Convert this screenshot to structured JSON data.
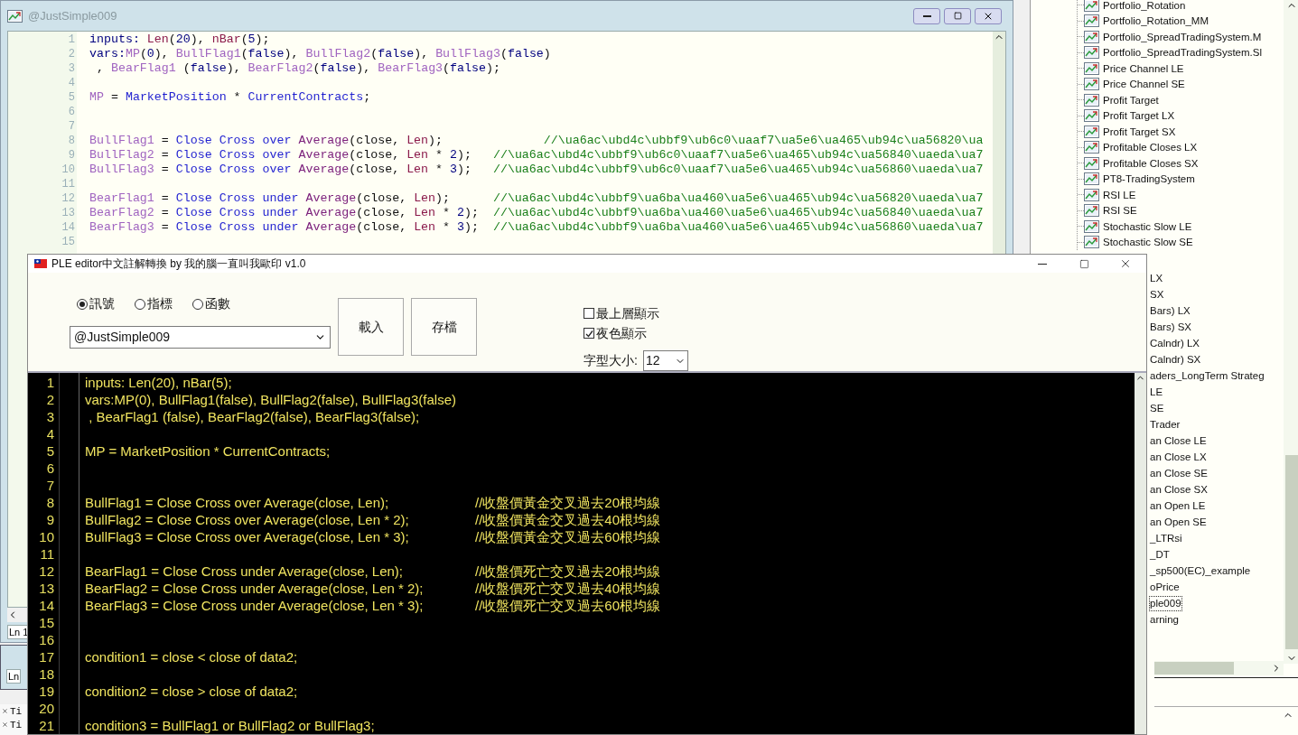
{
  "editor_window": {
    "title": "@JustSimple009",
    "lines": [
      {
        "number": "1",
        "tokens": [
          {
            "text": "inputs: ",
            "kind": "kw"
          },
          {
            "text": "Len",
            "kind": "inp"
          },
          {
            "text": "(",
            "kind": "p"
          },
          {
            "text": "20",
            "kind": "num"
          },
          {
            "text": "), ",
            "kind": "p"
          },
          {
            "text": "nBar",
            "kind": "inp"
          },
          {
            "text": "(",
            "kind": "p"
          },
          {
            "text": "5",
            "kind": "num"
          },
          {
            "text": ");",
            "kind": "p"
          }
        ]
      },
      {
        "number": "2",
        "tokens": [
          {
            "text": "vars:",
            "kind": "kw"
          },
          {
            "text": "MP",
            "kind": "var"
          },
          {
            "text": "(",
            "kind": "p"
          },
          {
            "text": "0",
            "kind": "num"
          },
          {
            "text": "), ",
            "kind": "p"
          },
          {
            "text": "BullFlag1",
            "kind": "var"
          },
          {
            "text": "(",
            "kind": "p"
          },
          {
            "text": "false",
            "kind": "kw"
          },
          {
            "text": "), ",
            "kind": "p"
          },
          {
            "text": "BullFlag2",
            "kind": "var"
          },
          {
            "text": "(",
            "kind": "p"
          },
          {
            "text": "false",
            "kind": "kw"
          },
          {
            "text": "), ",
            "kind": "p"
          },
          {
            "text": "BullFlag3",
            "kind": "var"
          },
          {
            "text": "(",
            "kind": "p"
          },
          {
            "text": "false",
            "kind": "kw"
          },
          {
            "text": ")",
            "kind": "p"
          }
        ]
      },
      {
        "number": "3",
        "tokens": [
          {
            "text": " , ",
            "kind": "p"
          },
          {
            "text": "BearFlag1",
            "kind": "var"
          },
          {
            "text": " (",
            "kind": "p"
          },
          {
            "text": "false",
            "kind": "kw"
          },
          {
            "text": "), ",
            "kind": "p"
          },
          {
            "text": "BearFlag2",
            "kind": "var"
          },
          {
            "text": "(",
            "kind": "p"
          },
          {
            "text": "false",
            "kind": "kw"
          },
          {
            "text": "), ",
            "kind": "p"
          },
          {
            "text": "BearFlag3",
            "kind": "var"
          },
          {
            "text": "(",
            "kind": "p"
          },
          {
            "text": "false",
            "kind": "kw"
          },
          {
            "text": ");",
            "kind": "p"
          }
        ]
      },
      {
        "number": "4"
      },
      {
        "number": "5",
        "tokens": [
          {
            "text": "MP",
            "kind": "var"
          },
          {
            "text": " = ",
            "kind": "p"
          },
          {
            "text": "MarketPosition",
            "kind": "fn"
          },
          {
            "text": " * ",
            "kind": "p"
          },
          {
            "text": "CurrentContracts",
            "kind": "fn"
          },
          {
            "text": ";",
            "kind": "p"
          }
        ]
      },
      {
        "number": "6"
      },
      {
        "number": "7"
      },
      {
        "number": "8",
        "tokens": [
          {
            "text": "BullFlag1",
            "kind": "var"
          },
          {
            "text": " = ",
            "kind": "p"
          },
          {
            "text": "Close Cross over ",
            "kind": "fn"
          },
          {
            "text": "Average",
            "kind": "avg"
          },
          {
            "text": "(close, ",
            "kind": "p"
          },
          {
            "text": "Len",
            "kind": "inp"
          },
          {
            "text": ");              ",
            "kind": "p"
          },
          {
            "text": "//\\ua6ac\\ubd4c\\ubbf9\\ub6c0\\uaaf7\\ua5e6\\ua465\\ub94c\\ua56820\\ua",
            "kind": "cm"
          }
        ]
      },
      {
        "number": "9",
        "tokens": [
          {
            "text": "BullFlag2",
            "kind": "var"
          },
          {
            "text": " = ",
            "kind": "p"
          },
          {
            "text": "Close Cross over ",
            "kind": "fn"
          },
          {
            "text": "Average",
            "kind": "avg"
          },
          {
            "text": "(close, ",
            "kind": "p"
          },
          {
            "text": "Len",
            "kind": "inp"
          },
          {
            "text": " * ",
            "kind": "p"
          },
          {
            "text": "2",
            "kind": "num"
          },
          {
            "text": ");   ",
            "kind": "p"
          },
          {
            "text": "//\\ua6ac\\ubd4c\\ubbf9\\ub6c0\\uaaf7\\ua5e6\\ua465\\ub94c\\ua56840\\uaeda\\ua7",
            "kind": "cm"
          }
        ]
      },
      {
        "number": "10",
        "tokens": [
          {
            "text": "BullFlag3",
            "kind": "var"
          },
          {
            "text": " = ",
            "kind": "p"
          },
          {
            "text": "Close Cross over ",
            "kind": "fn"
          },
          {
            "text": "Average",
            "kind": "avg"
          },
          {
            "text": "(close, ",
            "kind": "p"
          },
          {
            "text": "Len",
            "kind": "inp"
          },
          {
            "text": " * ",
            "kind": "p"
          },
          {
            "text": "3",
            "kind": "num"
          },
          {
            "text": ");   ",
            "kind": "p"
          },
          {
            "text": "//\\ua6ac\\ubd4c\\ubbf9\\ub6c0\\uaaf7\\ua5e6\\ua465\\ub94c\\ua56860\\uaeda\\ua7",
            "kind": "cm"
          }
        ]
      },
      {
        "number": "11"
      },
      {
        "number": "12",
        "tokens": [
          {
            "text": "BearFlag1",
            "kind": "var"
          },
          {
            "text": " = ",
            "kind": "p"
          },
          {
            "text": "Close Cross under ",
            "kind": "fn"
          },
          {
            "text": "Average",
            "kind": "avg"
          },
          {
            "text": "(close, ",
            "kind": "p"
          },
          {
            "text": "Len",
            "kind": "inp"
          },
          {
            "text": ");      ",
            "kind": "p"
          },
          {
            "text": "//\\ua6ac\\ubd4c\\ubbf9\\ua6ba\\ua460\\ua5e6\\ua465\\ub94c\\ua56820\\uaeda\\ua7",
            "kind": "cm"
          }
        ]
      },
      {
        "number": "13",
        "tokens": [
          {
            "text": "BearFlag2",
            "kind": "var"
          },
          {
            "text": " = ",
            "kind": "p"
          },
          {
            "text": "Close Cross under ",
            "kind": "fn"
          },
          {
            "text": "Average",
            "kind": "avg"
          },
          {
            "text": "(close, ",
            "kind": "p"
          },
          {
            "text": "Len",
            "kind": "inp"
          },
          {
            "text": " * ",
            "kind": "p"
          },
          {
            "text": "2",
            "kind": "num"
          },
          {
            "text": ");  ",
            "kind": "p"
          },
          {
            "text": "//\\ua6ac\\ubd4c\\ubbf9\\ua6ba\\ua460\\ua5e6\\ua465\\ub94c\\ua56840\\uaeda\\ua7",
            "kind": "cm"
          }
        ]
      },
      {
        "number": "14",
        "tokens": [
          {
            "text": "BearFlag3",
            "kind": "var"
          },
          {
            "text": " = ",
            "kind": "p"
          },
          {
            "text": "Close Cross under ",
            "kind": "fn"
          },
          {
            "text": "Average",
            "kind": "avg"
          },
          {
            "text": "(close, ",
            "kind": "p"
          },
          {
            "text": "Len",
            "kind": "inp"
          },
          {
            "text": " * ",
            "kind": "p"
          },
          {
            "text": "3",
            "kind": "num"
          },
          {
            "text": ");  ",
            "kind": "p"
          },
          {
            "text": "//\\ua6ac\\ubd4c\\ubbf9\\ua6ba\\ua460\\ua5e6\\ua465\\ub94c\\ua56860\\uaeda\\ua7",
            "kind": "cm"
          }
        ]
      },
      {
        "number": "15"
      }
    ]
  },
  "left_status": {
    "position_1": "Ln 1",
    "position_2": "Ln",
    "log_lines": [
      "Ti",
      "Ti"
    ]
  },
  "strategy_tree": {
    "items": [
      {
        "label": "Portfolio_Rotation",
        "selected": false
      },
      {
        "label": "Portfolio_Rotation_MM",
        "selected": false
      },
      {
        "label": "Portfolio_SpreadTradingSystem.M",
        "selected": false
      },
      {
        "label": "Portfolio_SpreadTradingSystem.Sl",
        "selected": false
      },
      {
        "label": "Price Channel LE",
        "selected": false
      },
      {
        "label": "Price Channel SE",
        "selected": false
      },
      {
        "label": "Profit Target",
        "selected": false
      },
      {
        "label": "Profit Target LX",
        "selected": false
      },
      {
        "label": "Profit Target SX",
        "selected": false
      },
      {
        "label": "Profitable Closes LX",
        "selected": false
      },
      {
        "label": "Profitable Closes SX",
        "selected": false
      },
      {
        "label": "PT8-TradingSystem",
        "selected": false
      },
      {
        "label": "RSI LE",
        "selected": false
      },
      {
        "label": "RSI SE",
        "selected": false
      },
      {
        "label": "Stochastic Slow LE",
        "selected": false
      },
      {
        "label": "Stochastic Slow SE",
        "selected": false
      }
    ],
    "covered_items": [
      {
        "label": "LX",
        "selected": false
      },
      {
        "label": "SX",
        "selected": false
      },
      {
        "label": "Bars) LX",
        "selected": false
      },
      {
        "label": "Bars) SX",
        "selected": false
      },
      {
        "label": "Calndr) LX",
        "selected": false
      },
      {
        "label": "Calndr) SX",
        "selected": false
      },
      {
        "label": "aders_LongTerm Strateg",
        "selected": false
      },
      {
        "label": "LE",
        "selected": false
      },
      {
        "label": "SE",
        "selected": false
      },
      {
        "label": "Trader",
        "selected": false
      },
      {
        "label": "an Close LE",
        "selected": false
      },
      {
        "label": "an Close LX",
        "selected": false
      },
      {
        "label": "an Close SE",
        "selected": false
      },
      {
        "label": "an Close SX",
        "selected": false
      },
      {
        "label": "an Open LE",
        "selected": false
      },
      {
        "label": "an Open SE",
        "selected": false
      },
      {
        "label": "_LTRsi",
        "selected": false
      },
      {
        "label": "_DT",
        "selected": false
      },
      {
        "label": "_sp500(EC)_example",
        "selected": false
      },
      {
        "label": "oPrice",
        "selected": false
      },
      {
        "label": "ple009",
        "selected": true
      },
      {
        "label": "arning",
        "selected": false
      }
    ]
  },
  "dialog": {
    "title": "PLE editor中文註解轉換 by 我的腦一直叫我歐印 v1.0",
    "modes": [
      {
        "label": "訊號",
        "selected": true
      },
      {
        "label": "指標",
        "selected": false
      },
      {
        "label": "函數",
        "selected": false
      }
    ],
    "file_select": {
      "value": "@JustSimple009"
    },
    "buttons": [
      "載入",
      "存檔"
    ],
    "options": [
      {
        "label": "最上層顯示",
        "checked": false
      },
      {
        "label": "夜色顯示",
        "checked": true
      }
    ],
    "font_size": {
      "label": "字型大小:",
      "value": "12"
    },
    "code_lines": [
      {
        "number": "1",
        "code": "inputs: Len(20), nBar(5);"
      },
      {
        "number": "2",
        "code": "vars:MP(0), BullFlag1(false), BullFlag2(false), BullFlag3(false)"
      },
      {
        "number": "3",
        "code": " , BearFlag1 (false), BearFlag2(false), BearFlag3(false);"
      },
      {
        "number": "4"
      },
      {
        "number": "5",
        "code": "MP = MarketPosition * CurrentContracts;"
      },
      {
        "number": "6"
      },
      {
        "number": "7"
      },
      {
        "number": "8",
        "code": "BullFlag1 = Close Cross over Average(close, Len);",
        "comment": "//收盤價黃金交叉過去20根均線"
      },
      {
        "number": "9",
        "code": "BullFlag2 = Close Cross over Average(close, Len * 2);",
        "comment": "//收盤價黃金交叉過去40根均線"
      },
      {
        "number": "10",
        "code": "BullFlag3 = Close Cross over Average(close, Len * 3);",
        "comment": "//收盤價黃金交叉過去60根均線"
      },
      {
        "number": "11"
      },
      {
        "number": "12",
        "code": "BearFlag1 = Close Cross under Average(close, Len);",
        "comment": "//收盤價死亡交叉過去20根均線"
      },
      {
        "number": "13",
        "code": "BearFlag2 = Close Cross under Average(close, Len * 2);",
        "comment": "//收盤價死亡交叉過去40根均線"
      },
      {
        "number": "14",
        "code": "BearFlag3 = Close Cross under Average(close, Len * 3);",
        "comment": "//收盤價死亡交叉過去60根均線"
      },
      {
        "number": "15"
      },
      {
        "number": "16"
      },
      {
        "number": "17",
        "code": "condition1 = close < close of data2;"
      },
      {
        "number": "18"
      },
      {
        "number": "19",
        "code": "condition2 = close > close of data2;"
      },
      {
        "number": "20"
      },
      {
        "number": "21",
        "code": "condition3 = BullFlag1 or BullFlag2 or BullFlag3;"
      }
    ]
  }
}
